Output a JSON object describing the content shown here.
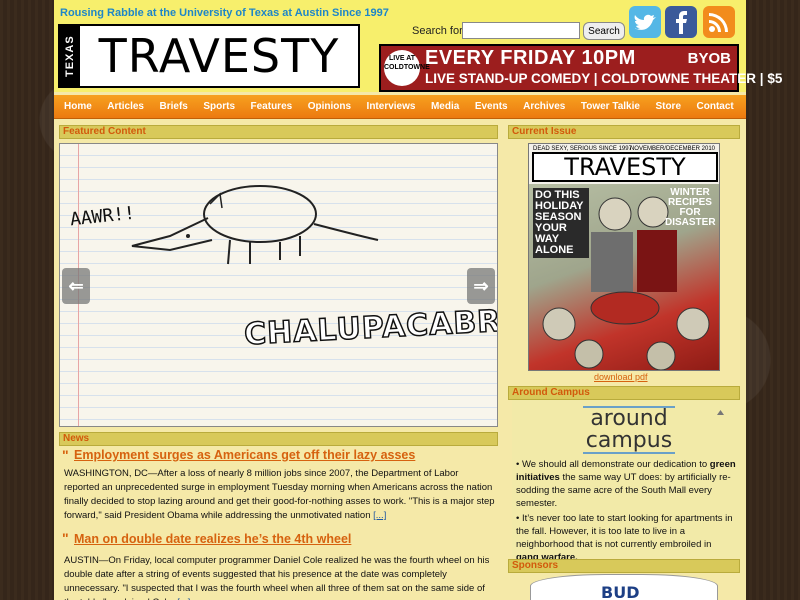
{
  "header": {
    "tagline": "Rousing Rabble at the University of Texas at Austin Since 1997",
    "logo_small": "TEXAS",
    "logo_main": "TRAVESTY",
    "search_label": "Search for:",
    "search_value": "",
    "search_button": "Search"
  },
  "social": [
    "twitter-icon",
    "facebook-icon",
    "rss-icon"
  ],
  "banner": {
    "badge": "LIVE AT COLDTOWNE",
    "top": "EVERY FRIDAY 10PM",
    "byob": "BYOB",
    "bottom": "LIVE STAND-UP COMEDY | COLDTOWNE THEATER | $5"
  },
  "nav": [
    "Home",
    "Articles",
    "Briefs",
    "Sports",
    "Features",
    "Opinions",
    "Interviews",
    "Media",
    "Events",
    "Archives",
    "Tower Talkie",
    "Store",
    "Contact"
  ],
  "featured": {
    "heading": "Featured Content",
    "caption1": "AAWR!!",
    "caption2": "CHALUPACABRA"
  },
  "news": {
    "heading": "News",
    "items": [
      {
        "title": "Employment surges as Americans get off their lazy asses",
        "body": "WASHINGTON, DC—After a loss of nearly 8 million jobs since 2007, the Department of Labor reported an unprecedented surge in employment Tuesday morning when Americans across the nation finally decided to stop lazing around and get their good-for-nothing asses to work. \"This is a major step forward,\" said President Obama while addressing the unmotivated nation",
        "more": "[...]"
      },
      {
        "title": "Man on double date realizes he’s the 4th wheel",
        "body": "AUSTIN—On Friday, local computer programmer Daniel Cole realized he was the fourth wheel on his double date after a string of events suggested that his presence at the date was completely unnecessary. \"I suspected that I was the fourth wheel when all three of them sat on the same side of the table,\" explained Cole,",
        "more": "[...]"
      }
    ]
  },
  "current_issue": {
    "heading": "Current Issue",
    "cover_tagline": "DEAD SEXY, SERIOUS SINCE 1997",
    "cover_date": "NOVEMBER/DECEMBER 2010",
    "cover_title": "TRAVESTY",
    "cover_left": "DO THIS HOLIDAY SEASON YOUR WAY ALONE",
    "cover_right": "WINTER RECIPES FOR DISASTER",
    "download": "download pdf"
  },
  "around_campus": {
    "heading": "Around Campus",
    "logo_line1": "around",
    "logo_line2": "campus",
    "bullets": [
      {
        "pre": "We should all demonstrate our dedication to ",
        "bold": "green initiatives",
        "post": " the same way UT does: by artificially re-sodding the same acre of the South Mall every semester."
      },
      {
        "pre": "It’s never too late to start looking for apartments in the fall. However, it is too late to live in a neighborhood that is not currently embroiled in ",
        "bold": "gang warfare.",
        "post": ""
      }
    ]
  },
  "sponsors": {
    "heading": "Sponsors",
    "logo_text": "BUD"
  },
  "colors": {
    "accent_orange": "#d6620f",
    "nav_orange": "#f08a15",
    "header_yellow": "#f7ef6c",
    "link_blue": "#1e56a0"
  }
}
